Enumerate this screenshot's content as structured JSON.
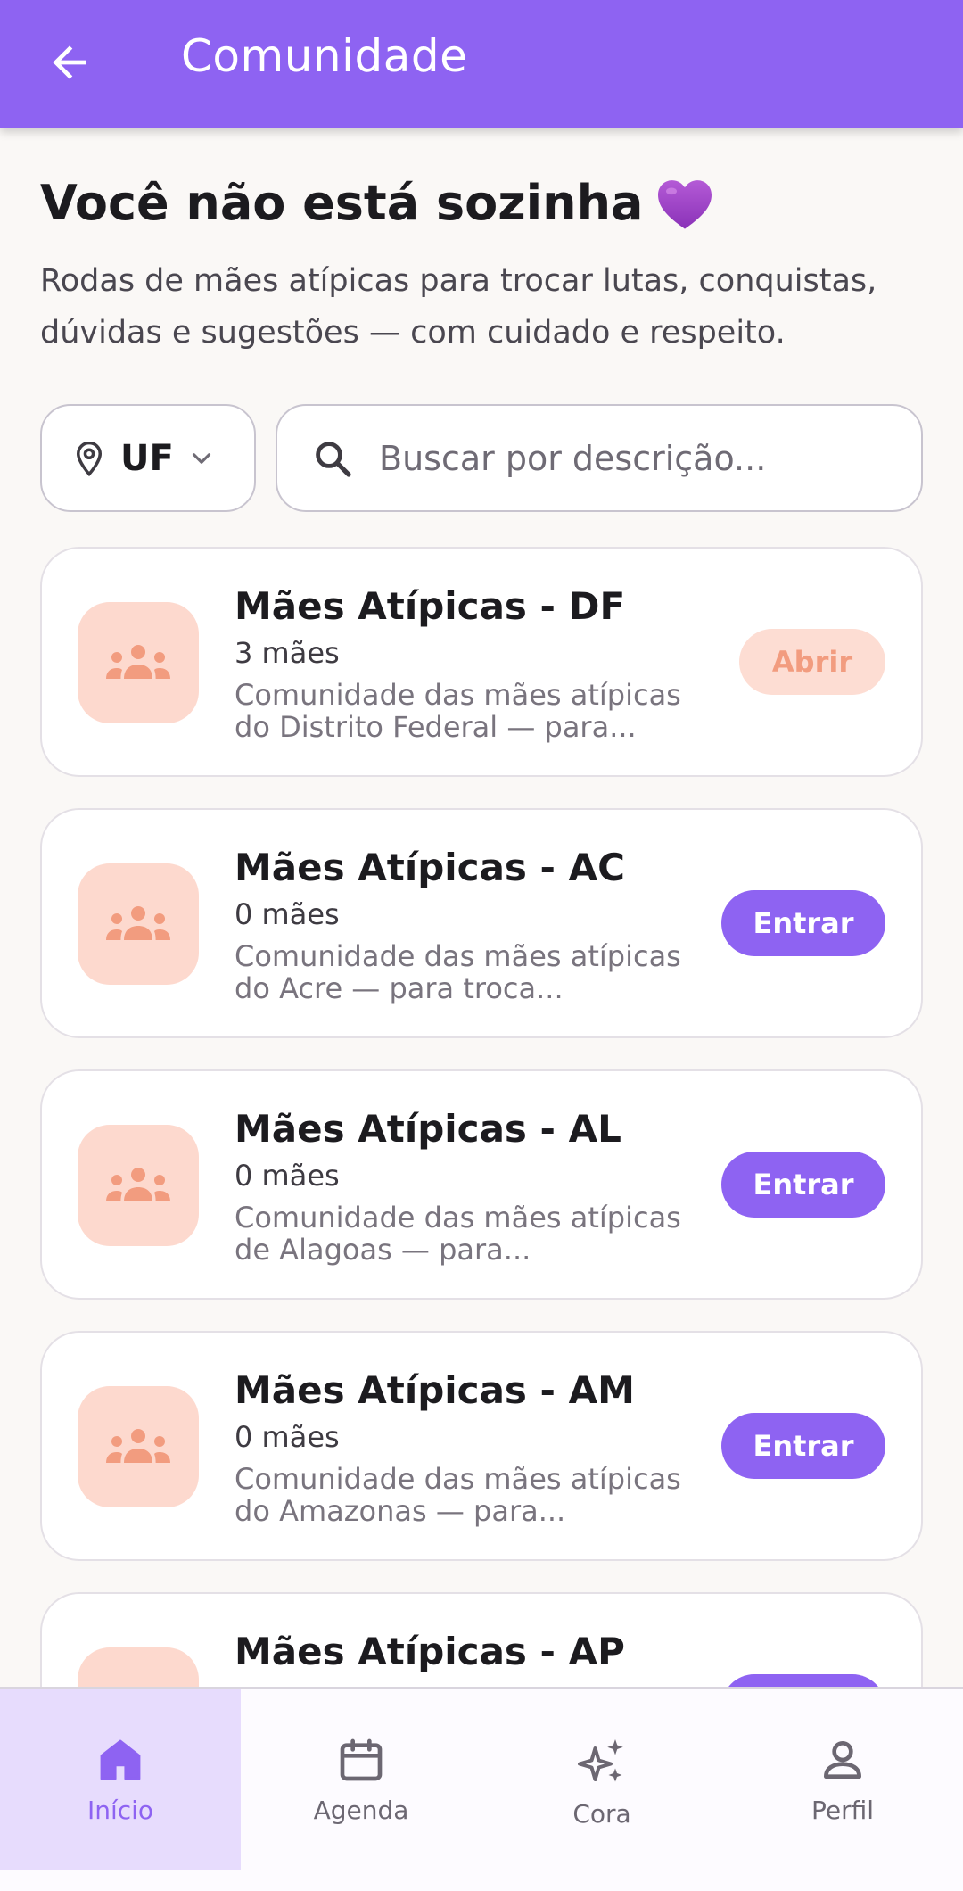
{
  "topbar": {
    "title": "Comunidade",
    "back_icon": "arrow-left-icon"
  },
  "header": {
    "headline": "Você não está sozinha",
    "headline_emoji": "purple-heart-icon",
    "subtitle": "Rodas de mães atípicas para trocar lutas, conquistas, dúvidas e sugestões — com cuidado e respeito."
  },
  "filters": {
    "uf_label": "UF",
    "search_placeholder": "Buscar por descrição..."
  },
  "communities": [
    {
      "title": "Mães Atípicas - DF",
      "count": "3 mães",
      "desc": "Comunidade das mães atípicas do Distrito Federal — para...",
      "button": "Abrir",
      "joined": true
    },
    {
      "title": "Mães Atípicas - AC",
      "count": "0 mães",
      "desc": "Comunidade das mães atípicas do Acre — para troca...",
      "button": "Entrar",
      "joined": false
    },
    {
      "title": "Mães Atípicas - AL",
      "count": "0 mães",
      "desc": "Comunidade das mães atípicas de Alagoas — para...",
      "button": "Entrar",
      "joined": false
    },
    {
      "title": "Mães Atípicas - AM",
      "count": "0 mães",
      "desc": "Comunidade das mães atípicas do Amazonas — para...",
      "button": "Entrar",
      "joined": false
    },
    {
      "title": "Mães Atípicas - AP",
      "count": "",
      "desc": "",
      "button": "",
      "joined": false
    }
  ],
  "nav": {
    "items": [
      {
        "label": "Início",
        "icon": "home-icon",
        "active": true
      },
      {
        "label": "Agenda",
        "icon": "calendar-icon",
        "active": false
      },
      {
        "label": "Cora",
        "icon": "sparkles-icon",
        "active": false
      },
      {
        "label": "Perfil",
        "icon": "person-icon",
        "active": false
      }
    ]
  },
  "colors": {
    "primary": "#8e63f2",
    "avatar_bg": "#fdd9ce",
    "avatar_icon": "#f29c7f",
    "nav_active_bg": "#e7dcfd"
  }
}
